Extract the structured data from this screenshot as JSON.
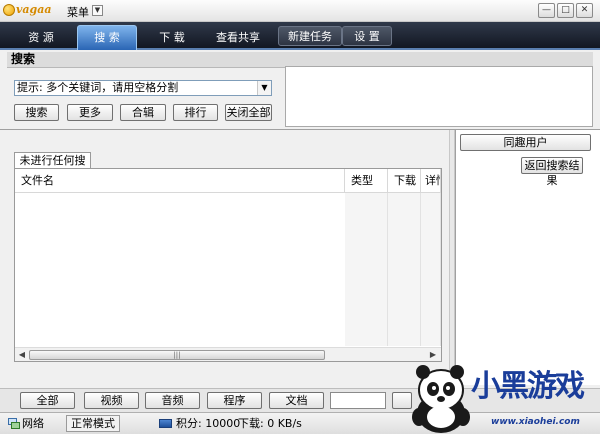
{
  "titlebar": {
    "logo_text": "vagaa",
    "menu_label": "菜单",
    "minimize": "—",
    "restore": "□",
    "close": "✕"
  },
  "tabs": [
    {
      "label": "资 源"
    },
    {
      "label": "搜 索"
    },
    {
      "label": "下 载"
    },
    {
      "label": "查看共享"
    },
    {
      "label": "新建任务"
    },
    {
      "label": "设 置"
    }
  ],
  "search": {
    "header": "搜索",
    "placeholder": "提示: 多个关键词，请用空格分割",
    "buttons": {
      "search": "搜索",
      "more": "更多",
      "album": "合辑",
      "rank": "排行",
      "close_all": "关闭全部"
    }
  },
  "results": {
    "tab_label": "未进行任何搜索",
    "columns": [
      "文件名",
      "类型",
      "下载",
      "详情"
    ]
  },
  "right_panel": {
    "same_interest_button": "同趣用户",
    "back_button": "返回搜索结果"
  },
  "filters": [
    "全部",
    "视频",
    "音频",
    "程序",
    "文档"
  ],
  "statusbar": {
    "network": "网络",
    "mode": "正常模式",
    "score_label": "积分: 10000",
    "download_label": "下载: 0 KB/s"
  },
  "watermark": {
    "brand": "小黑游戏",
    "url": "www.xiaohei.com"
  },
  "colors": {
    "tab_active": "#3f7fd0",
    "tabbar_dark": "#1a202b"
  }
}
